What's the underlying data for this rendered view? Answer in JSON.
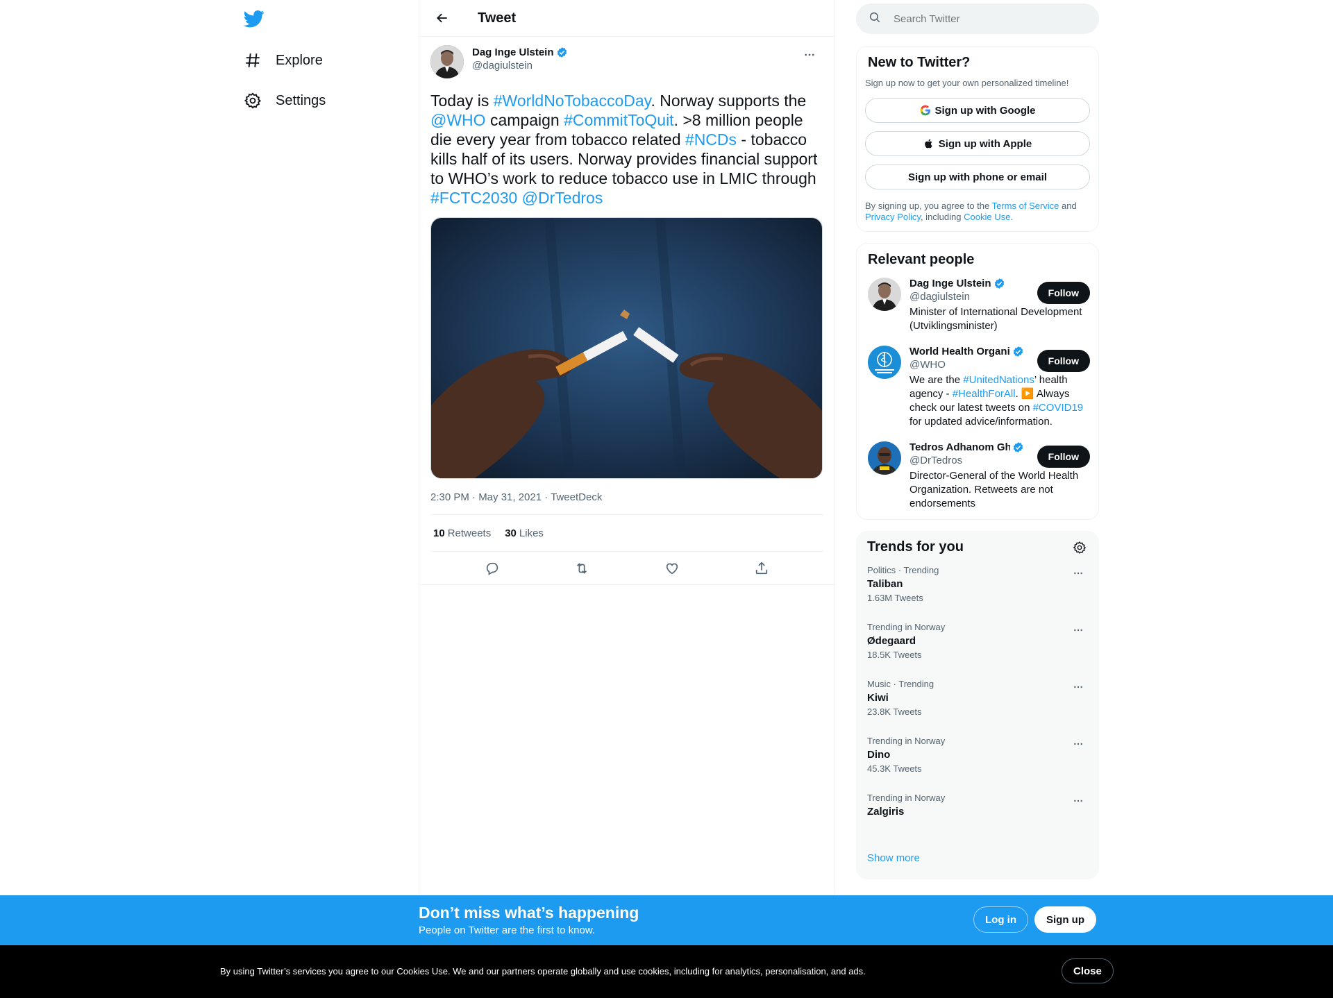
{
  "nav": {
    "explore": "Explore",
    "settings": "Settings"
  },
  "header": {
    "title": "Tweet"
  },
  "tweet": {
    "author_name": "Dag Inge Ulstein",
    "author_handle": "@dagiulstein",
    "text_parts": {
      "p1": "Today is ",
      "h1": "#WorldNoTobaccoDay",
      "p2": ". Norway supports the ",
      "m1": "@WHO",
      "p3": " campaign ",
      "h2": "#CommitToQuit",
      "p4": ". >8 million people die every year from tobacco related ",
      "h3": "#NCDs",
      "p5": " - tobacco kills half of its users. Norway provides financial support to WHO’s work to reduce tobacco use in LMIC through ",
      "h4": "#FCTC2030",
      "p6": " ",
      "m2": "@DrTedros"
    },
    "meta": "2:30 PM · May 31, 2021 · TweetDeck",
    "retweets_count": "10",
    "retweets_label": "Retweets",
    "likes_count": "30",
    "likes_label": "Likes"
  },
  "search": {
    "placeholder": "Search Twitter"
  },
  "new_to_twitter": {
    "title": "New to Twitter?",
    "subtitle": "Sign up now to get your own personalized timeline!",
    "google": "Sign up with Google",
    "apple": "Sign up with Apple",
    "phone": "Sign up with phone or email",
    "terms_prefix": "By signing up, you agree to the ",
    "terms_link": "Terms of Service",
    "terms_and": " and ",
    "privacy_link": "Privacy Policy",
    "terms_including": ", including ",
    "cookie_link": "Cookie Use."
  },
  "relevant": {
    "title": "Relevant people",
    "follow_label": "Follow",
    "people": [
      {
        "name": "Dag Inge Ulstein",
        "handle": "@dagiulstein",
        "bio": "Minister of International Development (Utviklingsminister)"
      },
      {
        "name": "World Health Organization (WHO)",
        "handle": "@WHO",
        "bio_parts": {
          "a": "We are the ",
          "l1": "#UnitedNations",
          "b": "’ health agency - ",
          "l2": "#HealthForAll",
          "c": ". ▶️ Always check our latest tweets on ",
          "l3": "#COVID19",
          "d": " for updated advice/information."
        }
      },
      {
        "name": "Tedros Adhanom Ghebreyesus",
        "handle": "@DrTedros",
        "bio": "Director-General of the World Health Organization. Retweets are not endorsements"
      }
    ]
  },
  "trends": {
    "title": "Trends for you",
    "items": [
      {
        "meta": "Politics · Trending",
        "name": "Taliban",
        "count": "1.63M Tweets"
      },
      {
        "meta": "Trending in Norway",
        "name": "Ødegaard",
        "count": "18.5K Tweets"
      },
      {
        "meta": "Music · Trending",
        "name": "Kiwi",
        "count": "23.8K Tweets"
      },
      {
        "meta": "Trending in Norway",
        "name": "Dino",
        "count": "45.3K Tweets"
      },
      {
        "meta": "Trending in Norway",
        "name": "Zalgiris",
        "count": ""
      }
    ],
    "show_more": "Show more"
  },
  "signup_bar": {
    "title": "Don’t miss what’s happening",
    "subtitle": "People on Twitter are the first to know.",
    "login": "Log in",
    "signup": "Sign up"
  },
  "cookie_bar": {
    "text": "By using Twitter’s services you agree to our Cookies Use. We and our partners operate globally and use cookies, including for analytics, personalisation, and ads.",
    "close": "Close"
  },
  "colors": {
    "accent": "#1d9bf0",
    "text": "#0f1419",
    "muted": "#536471"
  }
}
